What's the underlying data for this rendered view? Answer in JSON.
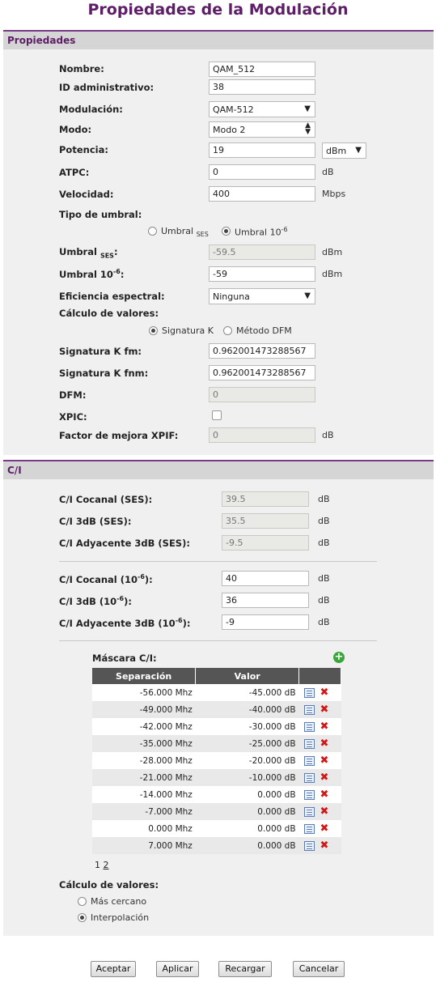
{
  "title": "Propiedades de la Modulación",
  "properties": {
    "header": "Propiedades",
    "nombre_label": "Nombre:",
    "nombre_value": "QAM_512",
    "id_label": "ID administrativo:",
    "id_value": "38",
    "modulacion_label": "Modulación:",
    "modulacion_value": "QAM-512",
    "modo_label": "Modo:",
    "modo_value": "Modo 2",
    "potencia_label": "Potencia:",
    "potencia_value": "19",
    "potencia_unit": "dBm",
    "atpc_label": "ATPC:",
    "atpc_value": "0",
    "atpc_unit": "dB",
    "velocidad_label": "Velocidad:",
    "velocidad_value": "400",
    "velocidad_unit": "Mbps",
    "tipo_umbral_label": "Tipo de umbral:",
    "tipo_umbral_ses_label": "Umbral",
    "tipo_umbral_ses_sub": "SES",
    "tipo_umbral_10_label": "Umbral 10",
    "tipo_umbral_10_sup": "-6",
    "umbral_ses_label": "Umbral",
    "umbral_ses_sub": "SES",
    "umbral_ses_value": "-59.5",
    "umbral_ses_unit": "dBm",
    "umbral_10_label": "Umbral 10",
    "umbral_10_sup": "-6",
    "umbral_10_value": "-59",
    "umbral_10_unit": "dBm",
    "eficiencia_label": "Eficiencia espectral:",
    "eficiencia_value": "Ninguna",
    "calculo_label": "Cálculo de valores:",
    "calculo_opt1": "Signatura K",
    "calculo_opt2": "Método DFM",
    "sigk_fm_label": "Signatura K fm:",
    "sigk_fm_value": "0.962001473288567",
    "sigk_fnm_label": "Signatura K fnm:",
    "sigk_fnm_value": "0.962001473288567",
    "dfm_label": "DFM:",
    "dfm_value": "0",
    "xpic_label": "XPIC:",
    "xpif_label": "Factor de mejora XPIF:",
    "xpif_value": "0",
    "xpif_unit": "dB"
  },
  "ci": {
    "header": "C/I",
    "cocanal_ses_label": "C/I Cocanal (SES):",
    "cocanal_ses_value": "39.5",
    "c3db_ses_label": "C/I 3dB (SES):",
    "c3db_ses_value": "35.5",
    "adyacente_ses_label": "C/I Adyacente 3dB (SES):",
    "adyacente_ses_value": "-9.5",
    "cocanal_10_label": "C/I Cocanal (10",
    "cocanal_10_value": "40",
    "c3db_10_label": "C/I 3dB (10",
    "c3db_10_value": "36",
    "adyacente_10_label": "C/I Adyacente 3dB (10",
    "adyacente_10_value": "-9",
    "sup": "-6",
    "close": "):",
    "unit": "dB",
    "mask_label": "Máscara C/I:",
    "col_sep": "Separación",
    "col_val": "Valor",
    "rows": [
      {
        "sep": "-56.000 Mhz",
        "val": "-45.000 dB"
      },
      {
        "sep": "-49.000 Mhz",
        "val": "-40.000 dB"
      },
      {
        "sep": "-42.000 Mhz",
        "val": "-30.000 dB"
      },
      {
        "sep": "-35.000 Mhz",
        "val": "-25.000 dB"
      },
      {
        "sep": "-28.000 Mhz",
        "val": "-20.000 dB"
      },
      {
        "sep": "-21.000 Mhz",
        "val": "-10.000 dB"
      },
      {
        "sep": "-14.000 Mhz",
        "val": "0.000 dB"
      },
      {
        "sep": "-7.000 Mhz",
        "val": "0.000 dB"
      },
      {
        "sep": "0.000 Mhz",
        "val": "0.000 dB"
      },
      {
        "sep": "7.000 Mhz",
        "val": "0.000 dB"
      }
    ],
    "page1": "1",
    "page2": "2",
    "calculo_label": "Cálculo de valores:",
    "calculo_opt1": "Más cercano",
    "calculo_opt2": "Interpolación"
  },
  "buttons": {
    "accept": "Aceptar",
    "apply": "Aplicar",
    "reload": "Recargar",
    "cancel": "Cancelar"
  },
  "colors": {
    "accent": "#5e1d67",
    "section_bg": "#f0f0f0",
    "header_bg": "#d5d5d5"
  },
  "icons": {
    "add": "add-icon",
    "edit": "edit-icon",
    "delete": "delete-icon"
  }
}
